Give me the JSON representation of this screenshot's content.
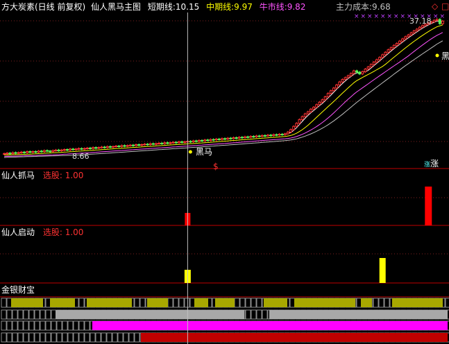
{
  "header": {
    "title": "方大炭素(日线 前复权)",
    "indicator": "仙人黑马主图",
    "short_label": "短期线:",
    "short_value": "10.15",
    "mid_label": "中期线:",
    "mid_value": "9.97",
    "bull_label": "牛市线:",
    "bull_value": "9.82",
    "cost_label": "主力成本:",
    "cost_value": "9.68"
  },
  "main": {
    "high_label": "37.18",
    "low_label": "8.66",
    "heima_mid": "黑马",
    "heima_right": "黑",
    "dollar_marker": "$",
    "zhang_marker": "涨",
    "zhang_prefix": "涨"
  },
  "panel1": {
    "title": "仙人抓马",
    "select_label": "选股:",
    "select_value": "1.00"
  },
  "panel2": {
    "title": "仙人启动",
    "select_label": "选股:",
    "select_value": "1.00"
  },
  "panel3": {
    "title": "金银财宝"
  },
  "colors": {
    "up": "#ff3232",
    "down": "#54ff54",
    "short": "#ffffff",
    "mid": "#ffff00",
    "bull": "#ff54ff",
    "cost": "#c0c0c0",
    "axis": "#c00000",
    "cursor": "#c0c0c0",
    "olive": "#a8a800",
    "gray": "#a8a8a8",
    "magenta": "#ff00ff",
    "darkred": "#c00000"
  },
  "chart_data": {
    "type": "candlestick",
    "total_bars": 150,
    "cursor_bar": 64,
    "price_range": [
      8.0,
      40.0
    ],
    "closes": [
      8.9,
      8.95,
      8.9,
      9.0,
      8.95,
      9.0,
      9.05,
      9.0,
      9.1,
      9.05,
      9.1,
      9.05,
      9.15,
      9.1,
      9.2,
      9.15,
      9.1,
      9.2,
      9.25,
      9.2,
      9.25,
      9.3,
      9.25,
      9.35,
      9.3,
      9.35,
      9.4,
      9.35,
      9.4,
      9.45,
      9.4,
      9.5,
      9.45,
      9.5,
      9.55,
      9.5,
      9.6,
      9.55,
      9.6,
      9.65,
      9.6,
      9.7,
      9.65,
      9.7,
      9.75,
      9.7,
      9.8,
      9.75,
      9.8,
      9.85,
      9.8,
      9.9,
      9.85,
      9.9,
      9.95,
      9.9,
      10.0,
      9.95,
      10.0,
      10.05,
      10.0,
      10.1,
      10.05,
      10.1,
      10.15,
      10.1,
      10.2,
      10.15,
      10.25,
      10.2,
      10.3,
      10.25,
      10.35,
      10.3,
      10.4,
      10.35,
      10.45,
      10.4,
      10.5,
      10.45,
      10.55,
      10.5,
      10.6,
      10.55,
      10.65,
      10.6,
      10.7,
      10.65,
      10.75,
      10.7,
      10.8,
      10.75,
      10.85,
      10.8,
      10.9,
      10.85,
      10.95,
      10.9,
      11.0,
      11.2,
      11.5,
      11.9,
      12.3,
      12.8,
      13.2,
      13.6,
      13.9,
      14.3,
      14.6,
      15.0,
      15.4,
      15.8,
      16.3,
      16.9,
      17.4,
      17.9,
      18.5,
      19.1,
      19.6,
      20.0,
      20.4,
      20.9,
      21.5,
      21.2,
      20.8,
      21.3,
      21.9,
      22.4,
      23.0,
      23.6,
      24.2,
      24.8,
      25.5,
      26.2,
      26.9,
      27.5,
      28.2,
      28.8,
      29.5,
      30.2,
      30.9,
      31.5,
      32.2,
      32.9,
      33.5,
      34.2,
      34.8,
      35.3,
      35.8,
      36.2,
      36.8,
      37.18,
      35.5,
      36.5
    ],
    "panel1_signals": [
      64,
      148
    ],
    "panel2_signals": [
      64,
      132
    ]
  }
}
